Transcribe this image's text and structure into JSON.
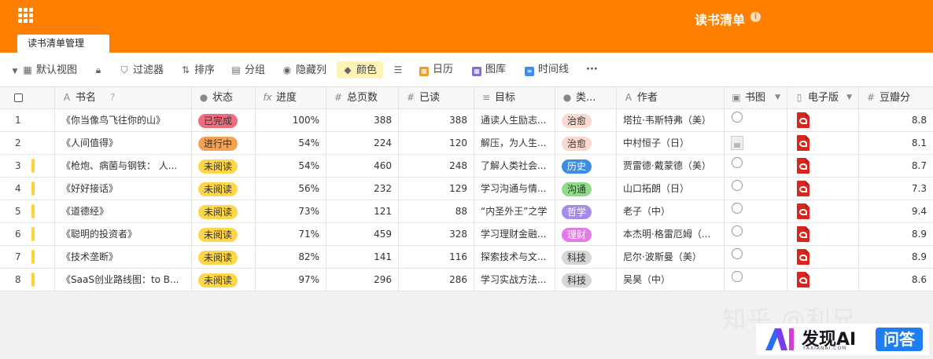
{
  "app": {
    "title": "读书清单",
    "tab": "读书清单管理"
  },
  "toolbar": {
    "view": "默认视图",
    "filter": "过滤器",
    "sort": "排序",
    "group": "分组",
    "hide": "隐藏列",
    "color": "颜色",
    "calendar": "日历",
    "gallery": "图库",
    "timeline": "时间线",
    "more": "···"
  },
  "columns": {
    "name": "书名",
    "status": "状态",
    "progress": "进度",
    "pages": "总页数",
    "read": "已读",
    "goal": "目标",
    "category": "类...",
    "author": "作者",
    "cover": "书图",
    "ebook": "电子版",
    "douban": "豆瓣分"
  },
  "colors": {
    "header": "#ff7f00",
    "status_done": "#f06b7c",
    "status_progress": "#f2a253",
    "status_unread": "#ffd54a"
  },
  "rows": [
    {
      "idx": "1",
      "name": "《你当像鸟飞往你的山》",
      "status": "已完成",
      "progress": "100%",
      "pages": "388",
      "read": "388",
      "goal": "通读人生励志...",
      "category": "治愈",
      "author": "塔拉·韦斯特弗（美）",
      "score": "8.8"
    },
    {
      "idx": "2",
      "name": "《人间值得》",
      "status": "进行中",
      "progress": "54%",
      "pages": "224",
      "read": "120",
      "goal": "解压，为人生...",
      "category": "治愈",
      "author": "中村恒子（日）",
      "score": "8.1"
    },
    {
      "idx": "3",
      "name": "《枪炮、病菌与钢铁： 人...",
      "status": "未阅读",
      "progress": "54%",
      "pages": "460",
      "read": "248",
      "goal": "了解人类社会...",
      "category": "历史",
      "author": "贾雷德·戴蒙德（美）",
      "score": "8.7"
    },
    {
      "idx": "4",
      "name": "《好好接话》",
      "status": "未阅读",
      "progress": "56%",
      "pages": "232",
      "read": "129",
      "goal": "学习沟通与情...",
      "category": "沟通",
      "author": "山口拓朗（日）",
      "score": "7.3"
    },
    {
      "idx": "5",
      "name": "《道德经》",
      "status": "未阅读",
      "progress": "73%",
      "pages": "121",
      "read": "88",
      "goal": "“内圣外王”之学",
      "category": "哲学",
      "author": "老子（中）",
      "score": "9.4"
    },
    {
      "idx": "6",
      "name": "《聪明的投资者》",
      "status": "未阅读",
      "progress": "71%",
      "pages": "459",
      "read": "328",
      "goal": "学习理财金融...",
      "category": "理财",
      "author": "本杰明·格雷厄姆（...",
      "score": "8.9"
    },
    {
      "idx": "7",
      "name": "《技术垄断》",
      "status": "未阅读",
      "progress": "82%",
      "pages": "141",
      "read": "116",
      "goal": "探索技术与文...",
      "category": "科技",
      "author": "尼尔·波斯曼（美）",
      "score": "8.9"
    },
    {
      "idx": "8",
      "name": "《SaaS创业路线图：to B...",
      "status": "未阅读",
      "progress": "97%",
      "pages": "296",
      "read": "286",
      "goal": "学习实战方法...",
      "category": "科技",
      "author": "吴昊（中）",
      "score": "8.6"
    }
  ],
  "watermark": "知乎 @利兄",
  "logo": {
    "text": "发现AI",
    "sub": "FAXIANAI.COM",
    "button": "问答"
  }
}
